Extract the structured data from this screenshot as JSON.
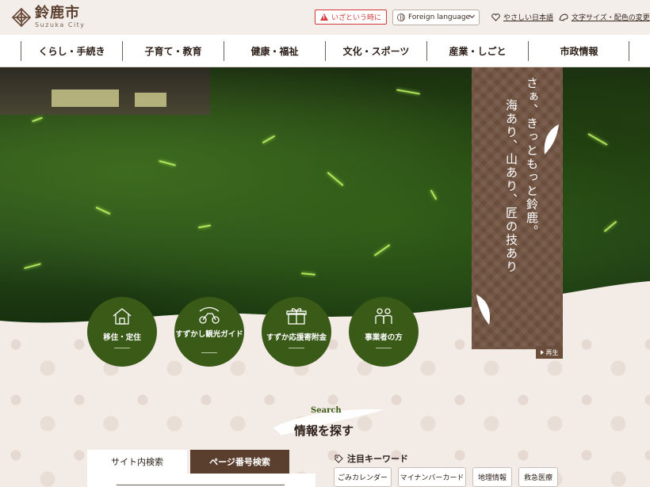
{
  "header": {
    "logo_title": "鈴鹿市",
    "logo_sub": "Suzuka City",
    "emergency_label": "いざという時に",
    "language_select": "Foreign language",
    "easy_japanese": "やさしい日本語",
    "font_color_settings": "文字サイズ・配色の変更"
  },
  "nav": {
    "items": [
      {
        "label": "くらし・手続き"
      },
      {
        "label": "子育て・教育"
      },
      {
        "label": "健康・福祉"
      },
      {
        "label": "文化・スポーツ"
      },
      {
        "label": "産業・しごと"
      },
      {
        "label": "市政情報"
      }
    ]
  },
  "hero": {
    "catch_line1": "さぁ、きっともっと鈴鹿。",
    "catch_line2": "海あり、山あり、匠の技あり",
    "play_label": "再生"
  },
  "quick_links": [
    {
      "label": "移住・定住",
      "icon": "house-icon"
    },
    {
      "label": "すずかし観光ガイド",
      "icon": "motorcycle-icon"
    },
    {
      "label": "すずか応援寄附金",
      "icon": "gift-icon"
    },
    {
      "label": "事業者の方",
      "icon": "people-icon"
    }
  ],
  "search": {
    "subtitle": "Search",
    "title": "情報を探す",
    "tab_site": "サイト内検索",
    "tab_page": "ページ番号検索"
  },
  "keywords": {
    "heading": "注目キーワード",
    "items": [
      "ごみカレンダー",
      "マイナンバーカード",
      "地理情報",
      "救急医療"
    ]
  },
  "colors": {
    "brand_brown": "#5a3e2e",
    "brand_green": "#3a5a17",
    "emergency_red": "#d23a3a"
  }
}
